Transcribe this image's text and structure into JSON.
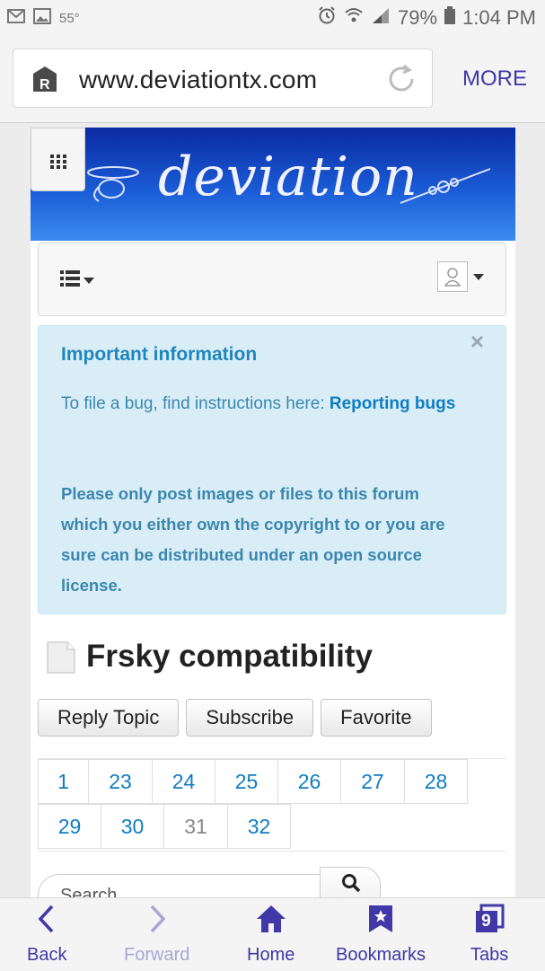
{
  "status_bar": {
    "temperature": "55°",
    "battery": "79%",
    "time": "1:04 PM"
  },
  "browser": {
    "url": "www.deviationtx.com",
    "more_label": "MORE"
  },
  "banner": {
    "logo_text": "deviation"
  },
  "alert": {
    "title": "Important information",
    "intro_text": "To file a bug, find instructions here: ",
    "link_text": "Reporting bugs",
    "notice": "Please only post images or files to this forum which you either own the copyright to or you are sure can be distributed under an open source license."
  },
  "topic": {
    "title": "Frsky compatibility"
  },
  "buttons": {
    "reply": "Reply Topic",
    "subscribe": "Subscribe",
    "favorite": "Favorite"
  },
  "pagination": {
    "row1": [
      "1",
      "23",
      "24",
      "25",
      "26",
      "27",
      "28"
    ],
    "row2": [
      "29",
      "30",
      "31",
      "32"
    ],
    "current": "31"
  },
  "search": {
    "placeholder": "Search"
  },
  "bottom_nav": {
    "back": "Back",
    "forward": "Forward",
    "home": "Home",
    "bookmarks": "Bookmarks",
    "tabs": "Tabs",
    "tab_count": "9"
  },
  "colors": {
    "accent": "#3f38a6",
    "link": "#0f7dc2",
    "alert_bg": "#d9edf7",
    "banner": "#1a5bd6"
  }
}
